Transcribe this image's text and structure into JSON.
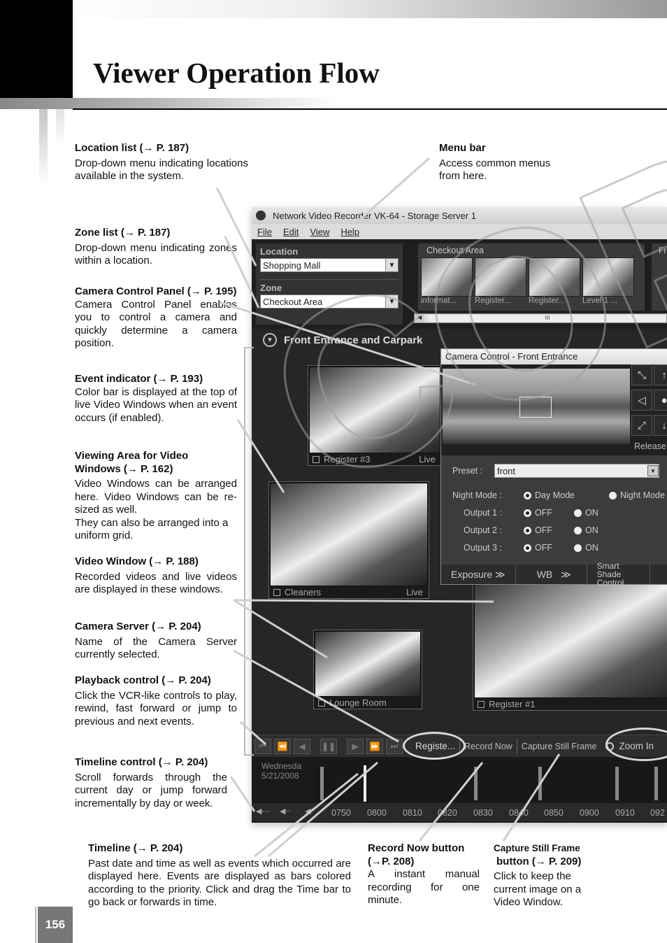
{
  "page": {
    "title": "Viewer Operation Flow",
    "page_number": "156",
    "watermark": "COPY"
  },
  "annotations": {
    "location_list": {
      "title": "Location list (→ P. 187)",
      "body": "Drop-down menu indicating locations available in the system."
    },
    "menu_bar": {
      "title": "Menu bar",
      "body": "Access common menus from here."
    },
    "zone_list": {
      "title": "Zone list (→ P. 187)",
      "body": "Drop-down menu indicating zones within a location."
    },
    "camera_control_panel": {
      "title": "Camera Control Panel (→ P. 195)",
      "body": "Camera Control Panel enables you to control a camera and quickly determine a camera position."
    },
    "event_indicator": {
      "title": "Event indicator (→ P. 193)",
      "body": "Color bar is displayed at the top of live Video Windows when an event occurs (if enabled)."
    },
    "viewing_area": {
      "title": "Viewing Area for Video Windows (→ P. 162)",
      "body": "Video Windows can be arranged here. Video Windows can be re-sized as well.",
      "body2": "They can also be arranged into a uniform grid."
    },
    "video_window": {
      "title": "Video Window (→ P. 188)",
      "body": "Recorded videos and live videos are displayed in these windows."
    },
    "camera_server": {
      "title": "Camera Server (→ P. 204)",
      "body": "Name of the Camera Server currently selected."
    },
    "playback_control": {
      "title": "Playback control (→ P. 204)",
      "body": "Click the VCR-like controls to play, rewind, fast forward or jump to previous and next events."
    },
    "timeline_control": {
      "title": "Timeline control (→ P. 204)",
      "body": "Scroll forwards through the current day or jump forward incrementally by day or week."
    },
    "timeline": {
      "title": "Timeline (→ P. 204)",
      "body": "Past date and time as well as events which occurred are displayed here. Events are displayed as bars colored according to the priority. Click and drag the Time bar to go back or forwards in time."
    },
    "record_now": {
      "title": "Record Now button (→P. 208)",
      "body": "A instant manual recording for one minute."
    },
    "capture_still": {
      "title": "Capture Still Frame",
      "title2": "button (→ P. 209)",
      "body": "Click to keep the current image on a Video Window."
    }
  },
  "app": {
    "window_title": "Network Video Recorder VK-64 - Storage Server 1",
    "menu": [
      "File",
      "Edit",
      "View",
      "Help"
    ],
    "location_label": "Location",
    "location_value": "Shopping Mall",
    "zone_label": "Zone",
    "zone_value": "Checkout Area",
    "zone_tab": "Checkout Area",
    "zone_tab2": "Fr",
    "thumbnails": [
      "informat...",
      "Register...",
      "Register...",
      "Level 1 ...",
      "Fr"
    ],
    "area_title": "Front Entrance and Carpark",
    "video_windows": [
      {
        "name": "Register #3",
        "status": "Live"
      },
      {
        "name": "Cleaners",
        "status": "Live"
      },
      {
        "name": "Lounge Room",
        "status": ""
      },
      {
        "name": "Register #1",
        "status": ""
      }
    ],
    "camera_control": {
      "title": "Camera Control - Front Entrance",
      "release": "Release",
      "preset_label": "Preset :",
      "preset_value": "front",
      "night_mode_label": "Night Mode :",
      "day_mode": "Day Mode",
      "night_mode": "Night Mode",
      "outputs": [
        {
          "label": "Output 1 :",
          "off": "OFF",
          "on": "ON",
          "selected": "OFF"
        },
        {
          "label": "Output 2 :",
          "off": "OFF",
          "on": "ON",
          "selected": "OFF"
        },
        {
          "label": "Output 3 :",
          "off": "OFF",
          "on": "ON",
          "selected": "OFF"
        }
      ],
      "tabs": [
        "Exposure",
        "WB",
        "Smart Shade Control"
      ]
    },
    "playback": {
      "camera_name": "Registe...",
      "record_now": "Record Now",
      "capture_still": "Capture Still Frame",
      "zoom": "Zoom In"
    },
    "timeline": {
      "date_line1": "Wednesda",
      "date_line2": "5/21/2008",
      "ticks": [
        "0750",
        "0800",
        "0810",
        "0820",
        "0830",
        "0840",
        "0850",
        "0900",
        "0910",
        "092"
      ]
    }
  }
}
